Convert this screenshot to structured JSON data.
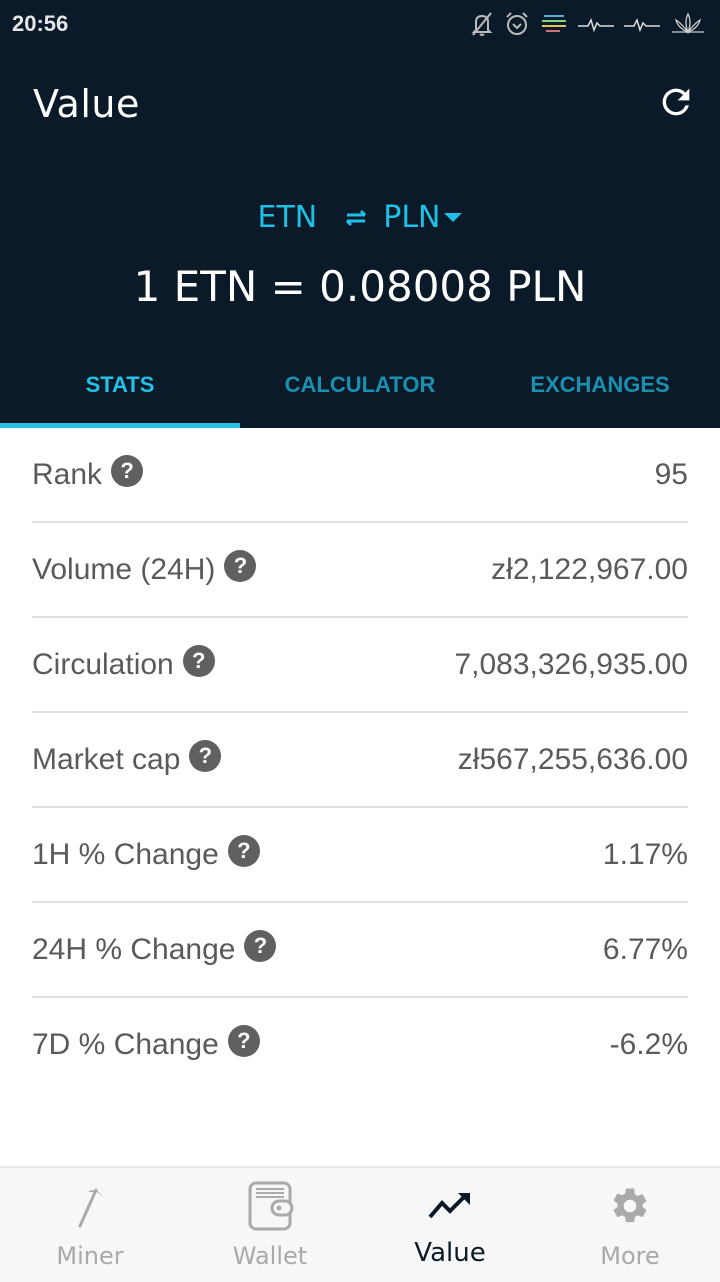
{
  "status_bar": {
    "time": "20:56",
    "icons": [
      "bell-off-icon",
      "alarm-icon",
      "notification-lines-icon",
      "heartbeat-icon",
      "heartbeat-icon",
      "lotus-icon"
    ]
  },
  "header": {
    "title": "Value",
    "refresh_icon": "refresh-icon"
  },
  "currency_pair": {
    "base": "ETN",
    "swap_icon": "swap-arrows-icon",
    "quote": "PLN",
    "dropdown_icon": "caret-down-icon",
    "rate_text": "1 ETN = 0.08008 PLN"
  },
  "colors": {
    "header_bg": "#0a1a28",
    "accent": "#26c0e6",
    "tab_inactive": "#1a8fb0",
    "text_gray": "#5a5a5a"
  },
  "tabs": [
    {
      "label": "STATS",
      "active": true
    },
    {
      "label": "CALCULATOR",
      "active": false
    },
    {
      "label": "EXCHANGES",
      "active": false
    }
  ],
  "stats": [
    {
      "label": "Rank",
      "value": "95"
    },
    {
      "label": "Volume (24H)",
      "value": "zł2,122,967.00"
    },
    {
      "label": "Circulation",
      "value": "7,083,326,935.00"
    },
    {
      "label": "Market cap",
      "value": "zł567,255,636.00"
    },
    {
      "label": "1H % Change",
      "value": "1.17%"
    },
    {
      "label": "24H % Change",
      "value": "6.77%"
    },
    {
      "label": "7D % Change",
      "value": "-6.2%"
    }
  ],
  "help_glyph": "?",
  "bottom_nav": [
    {
      "label": "Miner",
      "icon": "pickaxe-icon",
      "active": false
    },
    {
      "label": "Wallet",
      "icon": "wallet-icon",
      "active": false
    },
    {
      "label": "Value",
      "icon": "trending-up-icon",
      "active": true
    },
    {
      "label": "More",
      "icon": "gear-icon",
      "active": false
    }
  ]
}
